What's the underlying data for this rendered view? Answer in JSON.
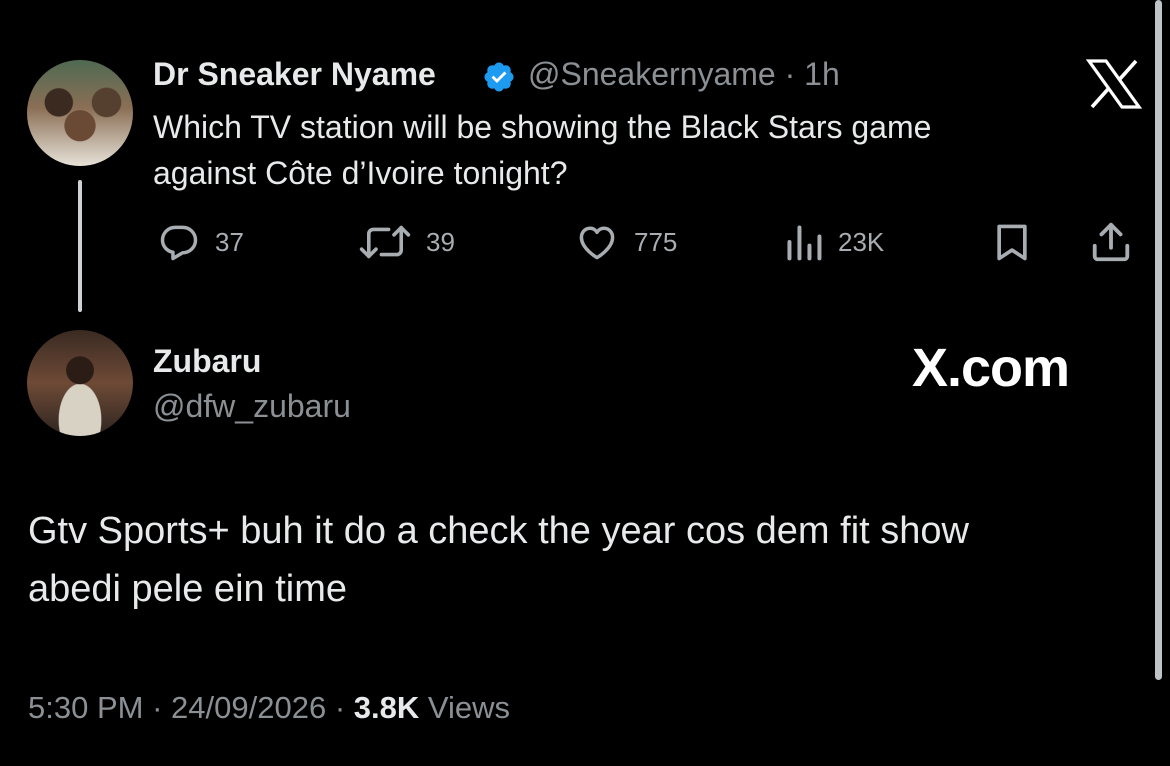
{
  "original_tweet": {
    "display_name": "Dr Sneaker Nyame",
    "handle": "@Sneakernyame",
    "separator": "·",
    "time_ago": "1h",
    "text_line1": "Which TV station will be showing the Black Stars game",
    "text_line2": "against Côte d’Ivoire tonight?",
    "actions": {
      "replies": "37",
      "reposts": "39",
      "likes": "775",
      "views": "23K"
    }
  },
  "reply_tweet": {
    "display_name": "Zubaru",
    "handle": "@dfw_zubaru",
    "text_line1": "Gtv Sports+ buh it do a check the year cos dem fit show",
    "text_line2": "abedi pele ein time",
    "footer": {
      "time": "5:30 PM",
      "sep1": "·",
      "date": "24/09/2026",
      "sep2": "·",
      "views_count": "3.8K",
      "views_label": "Views"
    }
  },
  "branding": {
    "watermark": "X.com"
  },
  "icons": {
    "verified": "verified-badge-icon",
    "reply": "reply-icon",
    "repost": "repost-icon",
    "like": "heart-icon",
    "views": "views-chart-icon",
    "bookmark": "bookmark-icon",
    "share": "share-icon",
    "x_logo": "x-logo-icon"
  },
  "colors": {
    "background": "#000000",
    "primary_text": "#e7e9ea",
    "secondary_text": "#8b9095",
    "verified_blue": "#1d9bf0"
  }
}
